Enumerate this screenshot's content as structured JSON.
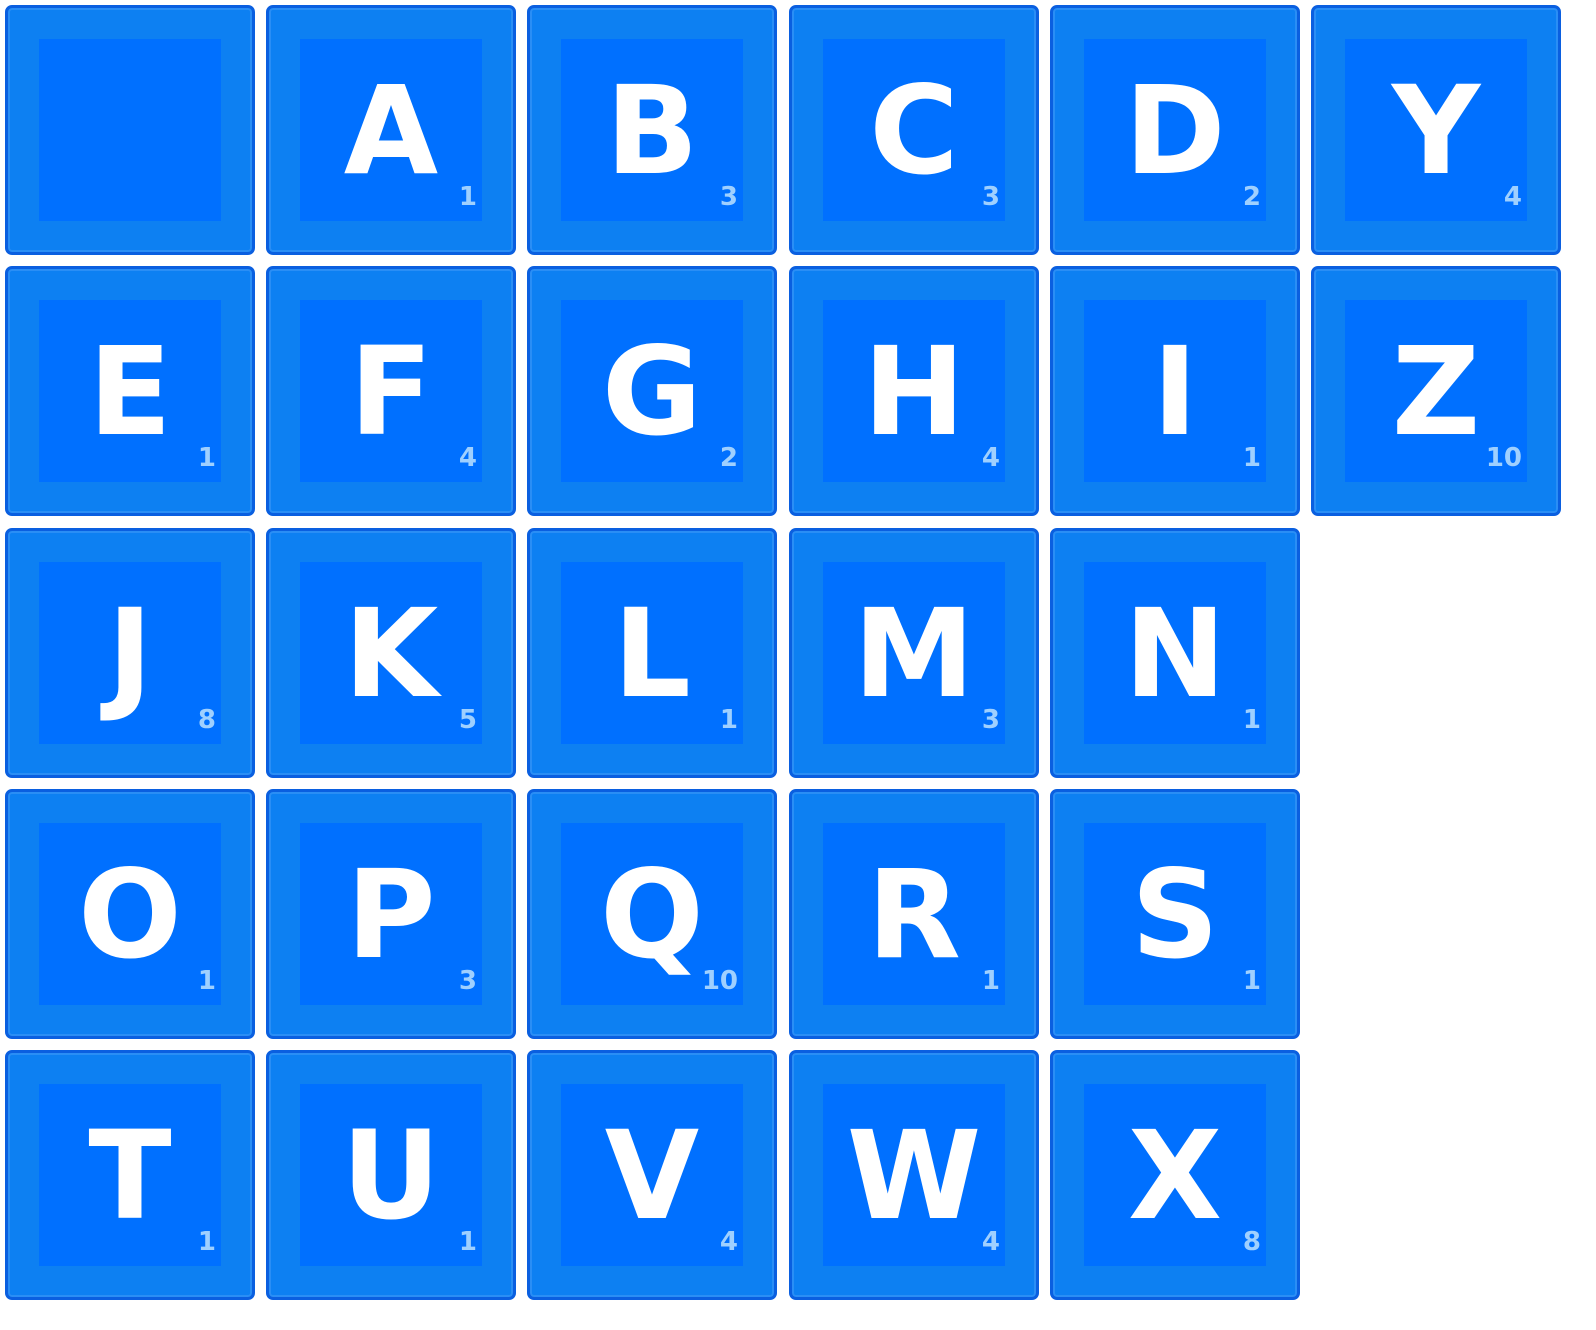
{
  "board": {
    "tiles": [
      {
        "letter": "",
        "points": ""
      },
      {
        "letter": "A",
        "points": "1"
      },
      {
        "letter": "B",
        "points": "3"
      },
      {
        "letter": "C",
        "points": "3"
      },
      {
        "letter": "D",
        "points": "2"
      },
      {
        "letter": "Y",
        "points": "4"
      },
      {
        "letter": "E",
        "points": "1"
      },
      {
        "letter": "F",
        "points": "4"
      },
      {
        "letter": "G",
        "points": "2"
      },
      {
        "letter": "H",
        "points": "4"
      },
      {
        "letter": "I",
        "points": "1"
      },
      {
        "letter": "Z",
        "points": "10"
      },
      {
        "letter": "J",
        "points": "8"
      },
      {
        "letter": "K",
        "points": "5"
      },
      {
        "letter": "L",
        "points": "1"
      },
      {
        "letter": "M",
        "points": "3"
      },
      {
        "letter": "N",
        "points": "1"
      },
      {
        "letter": "O",
        "points": "1"
      },
      {
        "letter": "P",
        "points": "3"
      },
      {
        "letter": "Q",
        "points": "10"
      },
      {
        "letter": "R",
        "points": "1"
      },
      {
        "letter": "S",
        "points": "1"
      },
      {
        "letter": "T",
        "points": "1"
      },
      {
        "letter": "U",
        "points": "1"
      },
      {
        "letter": "V",
        "points": "4"
      },
      {
        "letter": "W",
        "points": "4"
      },
      {
        "letter": "X",
        "points": "8"
      }
    ]
  },
  "colors": {
    "tile_border": "#0a5fe0",
    "tile_face": "#0d80f2",
    "tile_inner": "#0070ff",
    "letter": "#ffffff",
    "points": "#9fd0ff",
    "background": "#ffffff"
  }
}
